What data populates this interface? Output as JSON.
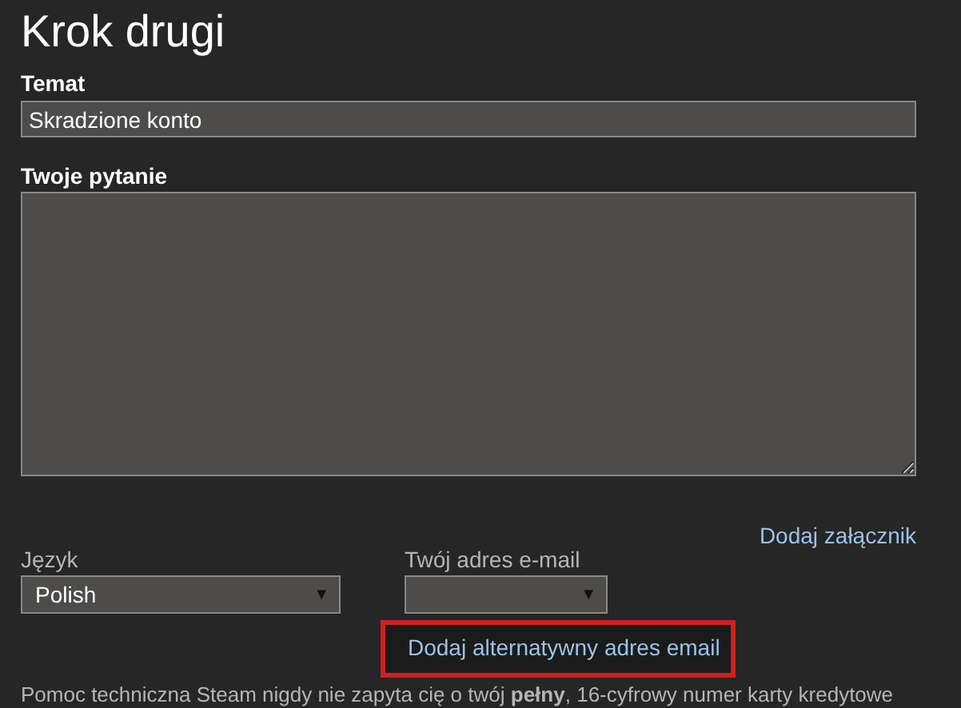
{
  "title": "Krok drugi",
  "subject": {
    "label": "Temat",
    "value": "Skradzione konto"
  },
  "question": {
    "label": "Twoje pytanie"
  },
  "attachment_link": "Dodaj załącznik",
  "language": {
    "label": "Język",
    "value": "Polish",
    "caret": "▼"
  },
  "email": {
    "label": "Twój adres e-mail",
    "caret": "▼"
  },
  "alt_email_link": {
    "text": "Dodaj alternatywny adres email",
    "highlighted": true
  },
  "notice": "Pomoc techniczna Steam nigdy nie zapyta cię o twój **pełny**, 16-cyfrowy numer karty kredytowe"
}
